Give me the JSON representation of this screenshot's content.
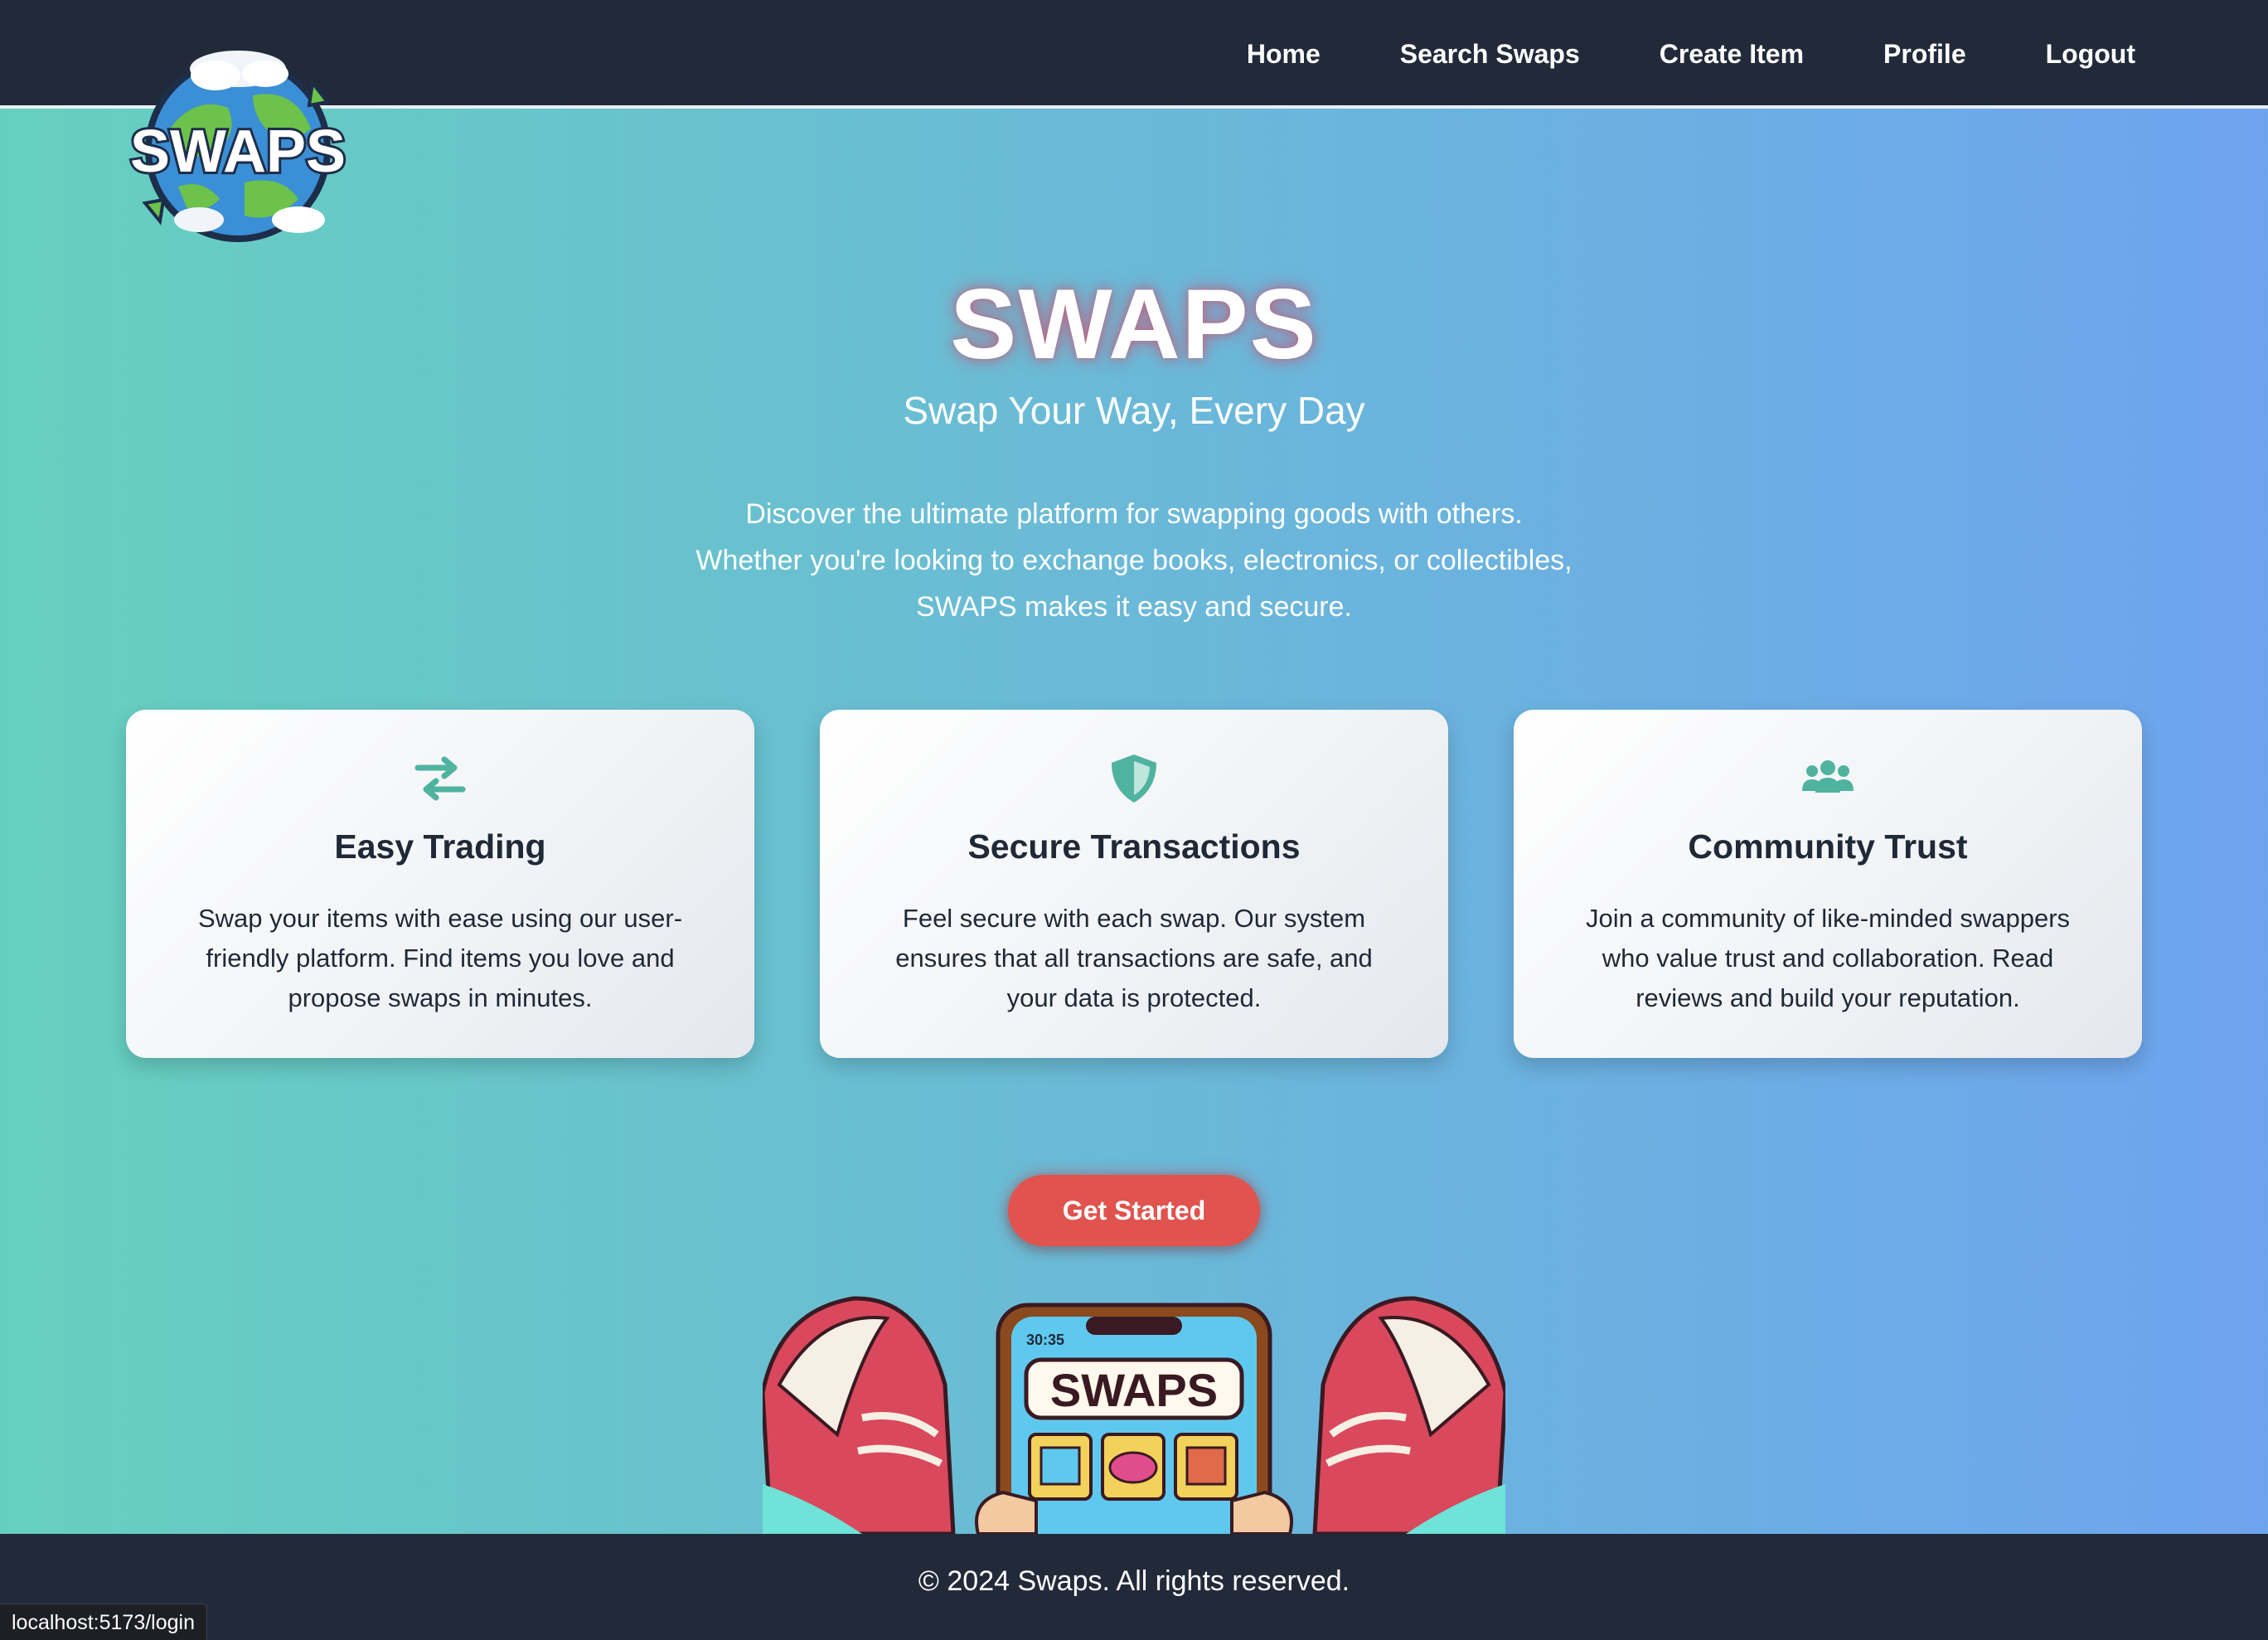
{
  "nav": {
    "links": [
      "Home",
      "Search Swaps",
      "Create Item",
      "Profile",
      "Logout"
    ]
  },
  "logo": {
    "text": "SWAPS",
    "icon": "globe-logo"
  },
  "hero": {
    "title": "SWAPS",
    "tagline": "Swap Your Way, Every Day",
    "description_lines": [
      "Discover the ultimate platform for swapping goods with others.",
      "Whether you're looking to exchange books, electronics, or collectibles,",
      "SWAPS makes it easy and secure."
    ]
  },
  "features": [
    {
      "icon": "exchange-arrows-icon",
      "title": "Easy Trading",
      "text": "Swap your items with ease using our user-friendly platform. Find items you love and propose swaps in minutes."
    },
    {
      "icon": "shield-icon",
      "title": "Secure Transactions",
      "text": "Feel secure with each swap. Our system ensures that all transactions are safe, and your data is protected."
    },
    {
      "icon": "users-icon",
      "title": "Community Trust",
      "text": "Join a community of like-minded swappers who value trust and collaboration. Read reviews and build your reputation."
    }
  ],
  "cta": {
    "label": "Get Started"
  },
  "illustration": {
    "phone_time": "30:35",
    "phone_title": "SWAPS"
  },
  "footer": {
    "text": "© 2024 Swaps. All rights reserved."
  },
  "status_bar": {
    "url": "localhost:5173/login"
  },
  "colors": {
    "nav_bg": "#222a3a",
    "gradient_start": "#66d0bf",
    "gradient_end": "#6ea4ef",
    "accent_teal": "#4fb3a0",
    "cta_red": "#e0534e"
  }
}
